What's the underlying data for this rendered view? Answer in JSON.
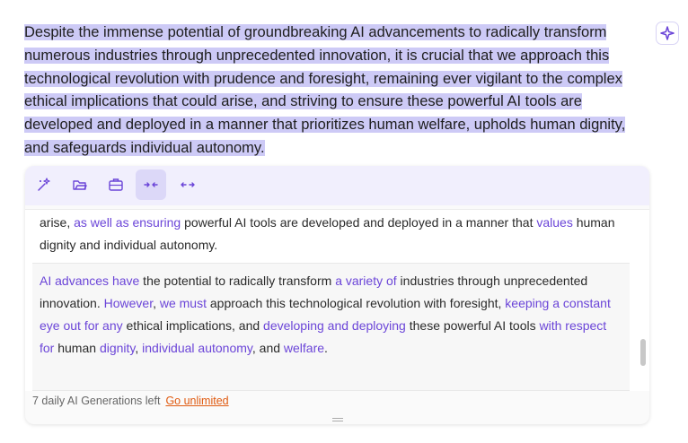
{
  "source_text": "Despite the immense potential of groundbreaking AI advancements to radically transform numerous industries through unprecedented innovation, it is crucial that we approach this technological revolution with prudence and foresight, remaining ever vigilant to the complex ethical implications that could arise, and striving to ensure these powerful AI tools are developed and deployed in a manner that prioritizes human welfare, upholds human dignity, and safeguards individual autonomy.",
  "toolbar": {
    "icons": [
      "magic-wand-icon",
      "folder-icon",
      "briefcase-icon",
      "shorten-icon",
      "expand-icon"
    ]
  },
  "result1": {
    "s1": "arise, ",
    "c1": "as well as ensuring",
    "s2": " powerful AI tools are developed and deployed in a manner that ",
    "c2": "values",
    "s3": " human dignity and individual autonomy."
  },
  "result2": {
    "c1": "AI advances have",
    "s1": " the potential to radically transform ",
    "c2": "a variety of",
    "s2": " industries through unprecedented innovation. ",
    "c3": "However",
    "s3": ", ",
    "c4": "we must",
    "s4": " approach this technological revolution with foresight, ",
    "c5": "keeping a constant eye out for any",
    "s5": " ethical implications, and ",
    "c6": "developing and deploying",
    "s6": " these powerful AI tools ",
    "c7": "with respect for",
    "s7": " human ",
    "c8": "dignity",
    "s8": ", ",
    "c9": "individual autonomy",
    "s9": ", and ",
    "c10": "welfare",
    "s10": "."
  },
  "footer": {
    "generations_left": "7 daily AI Generations left",
    "upgrade_link": "Go unlimited"
  },
  "colors": {
    "highlight": "#cdcaf6",
    "accent": "#6b45d8",
    "link": "#e05a10"
  }
}
